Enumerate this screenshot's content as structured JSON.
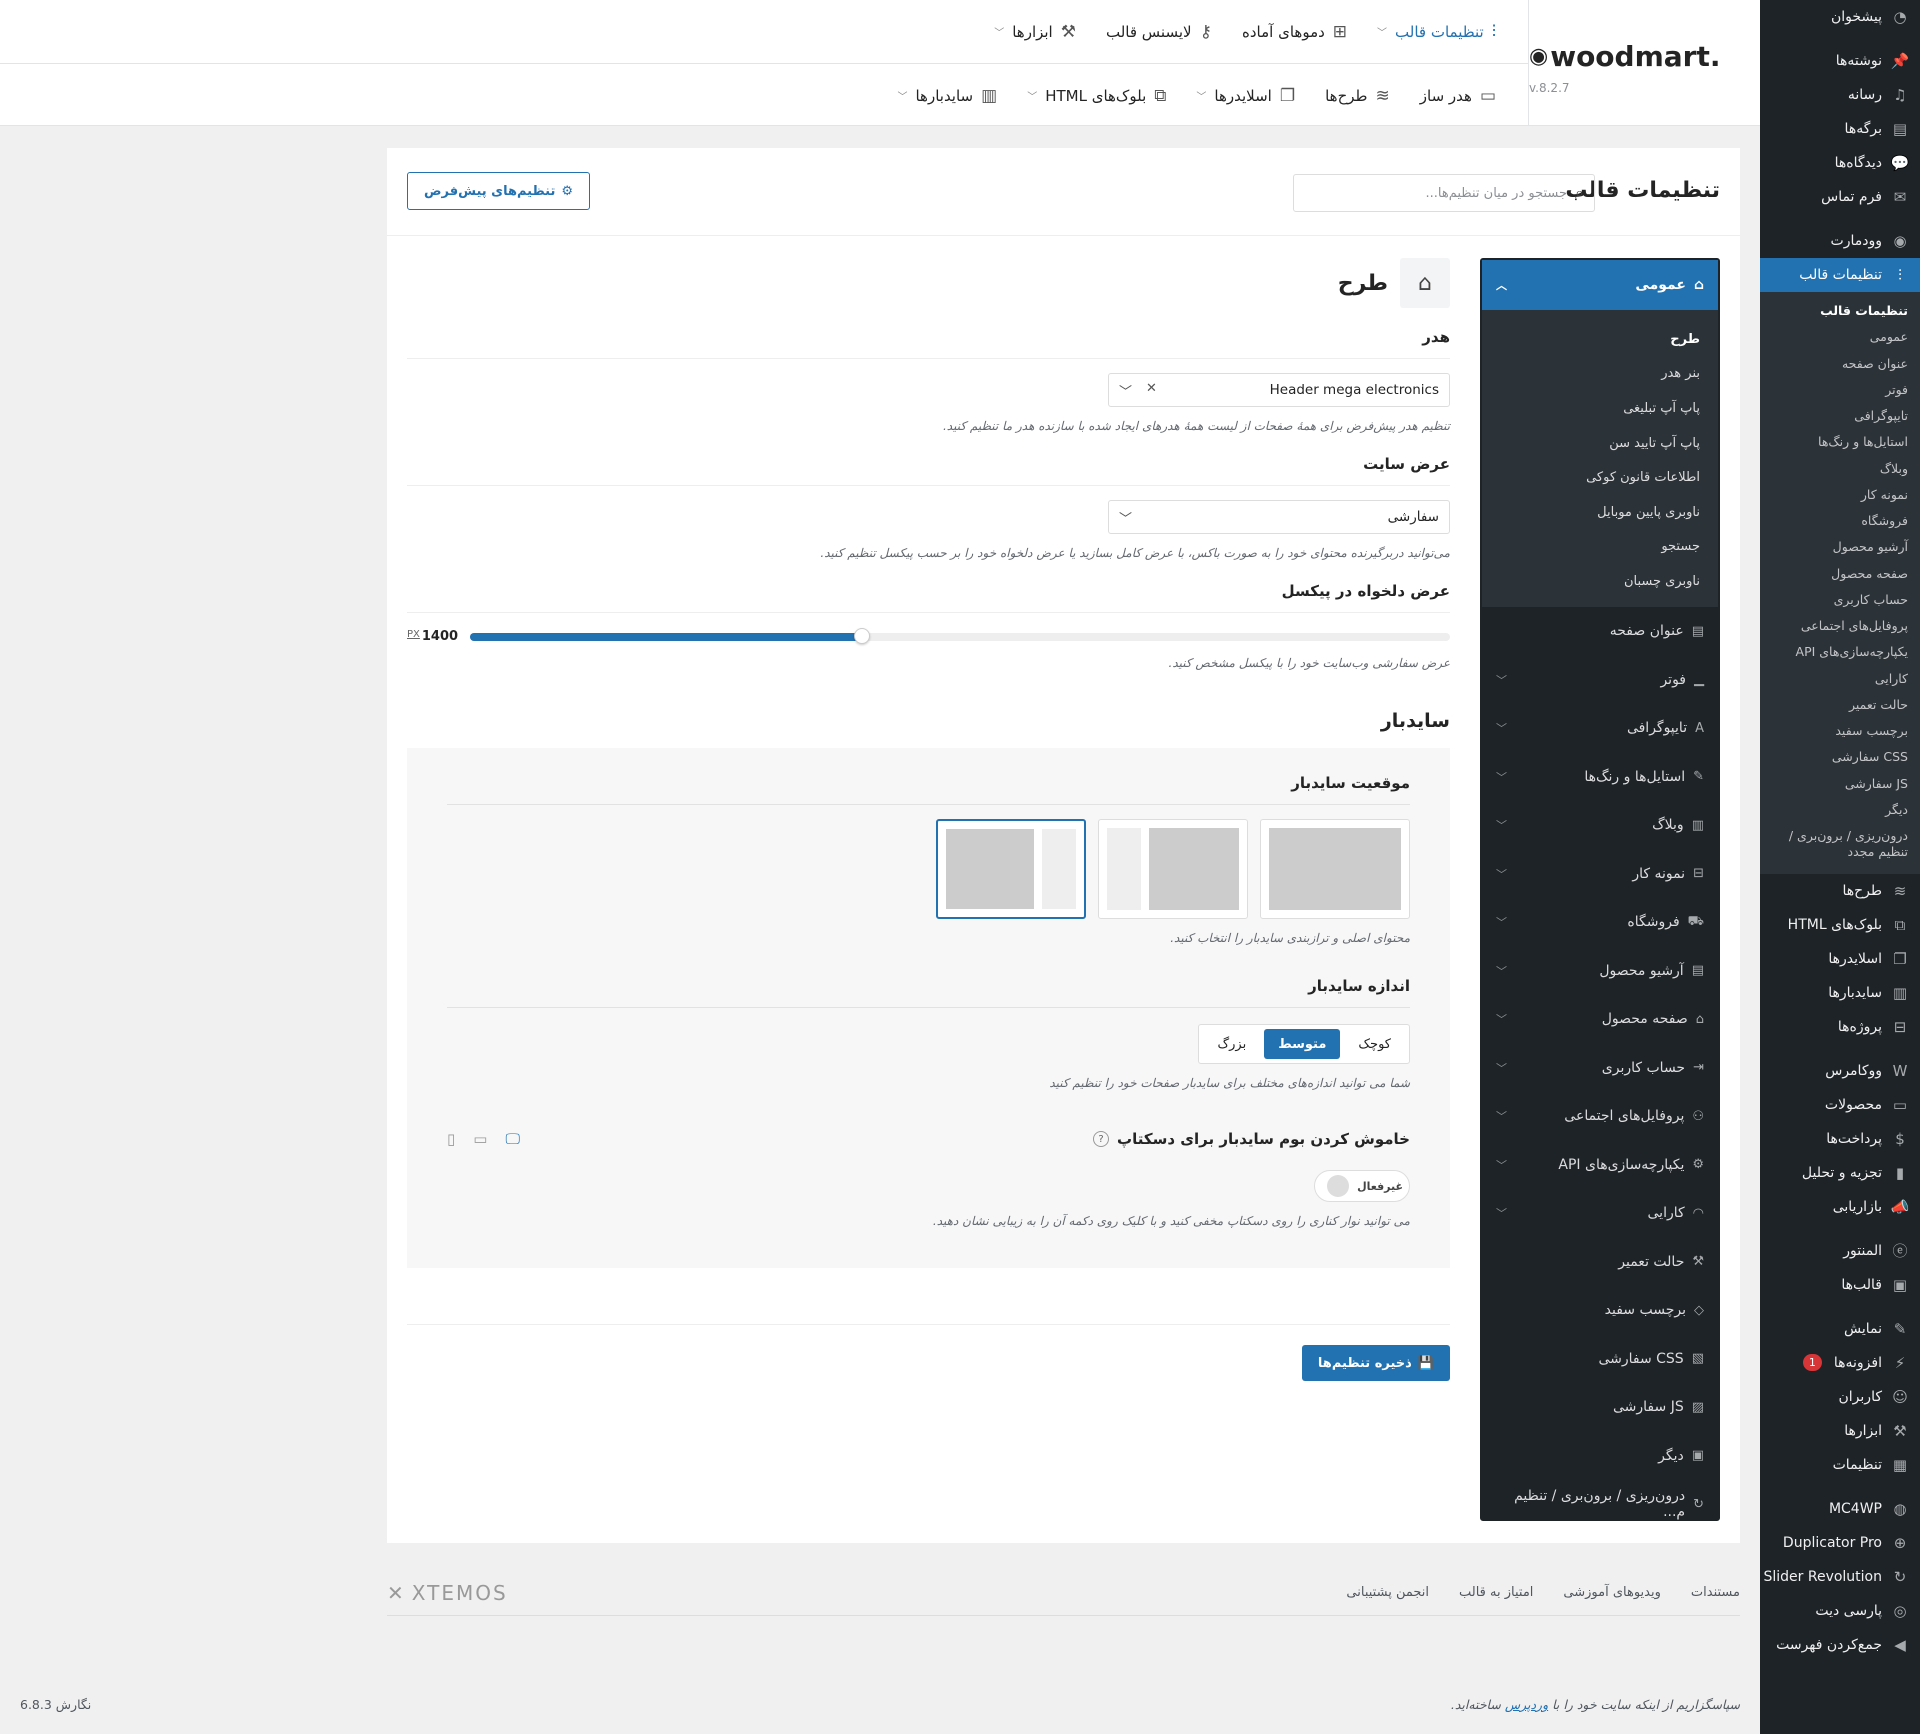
{
  "wp_sidebar": {
    "items_top": [
      {
        "label": "پیشخوان",
        "icon": "dashboard-icon"
      },
      {
        "label": "نوشته‌ها",
        "icon": "pin-icon",
        "sep": true
      },
      {
        "label": "رسانه",
        "icon": "media-icon"
      },
      {
        "label": "برگه‌ها",
        "icon": "page-icon"
      },
      {
        "label": "دیدگاه‌ها",
        "icon": "comment-icon"
      },
      {
        "label": "فرم تماس",
        "icon": "mail-icon"
      },
      {
        "label": "وودمارت",
        "icon": "woodmart-icon",
        "sep": true
      },
      {
        "label": "تنظیمات قالب",
        "icon": "sliders-icon",
        "active": true
      }
    ],
    "submenu": [
      {
        "label": "تنظیمات قالب",
        "current": true
      },
      {
        "label": "عمومی"
      },
      {
        "label": "عنوان صفحه"
      },
      {
        "label": "فوتر"
      },
      {
        "label": "تایپوگرافی"
      },
      {
        "label": "استایل‌ها و رنگ‌ها"
      },
      {
        "label": "وبلاگ"
      },
      {
        "label": "نمونه کار"
      },
      {
        "label": "فروشگاه"
      },
      {
        "label": "آرشیو محصول"
      },
      {
        "label": "صفحه محصول"
      },
      {
        "label": "حساب کاربری"
      },
      {
        "label": "پروفایل‌های اجتماعی"
      },
      {
        "label": "یکپارچه‌سازی‌های API"
      },
      {
        "label": "کارایی"
      },
      {
        "label": "حالت تعمیر"
      },
      {
        "label": "برچسب سفید"
      },
      {
        "label": "CSS سفارشی"
      },
      {
        "label": "JS سفارشی"
      },
      {
        "label": "دیگر"
      },
      {
        "label": "درون‌ریزی / برون‌بری / تنظیم مجدد"
      }
    ],
    "items_bottom": [
      {
        "label": "طرح‌ها",
        "icon": "layers-icon"
      },
      {
        "label": "بلوک‌های HTML",
        "icon": "html-block-icon"
      },
      {
        "label": "اسلایدرها",
        "icon": "slides-icon"
      },
      {
        "label": "سایدبارها",
        "icon": "sidebar-icon"
      },
      {
        "label": "پروژه‌ها",
        "icon": "portfolio-icon"
      },
      {
        "label": "ووکامرس",
        "icon": "woocommerce-icon",
        "sep": true
      },
      {
        "label": "محصولات",
        "icon": "products-icon"
      },
      {
        "label": "پرداخت‌ها",
        "icon": "payments-icon"
      },
      {
        "label": "تجزیه و تحلیل",
        "icon": "analytics-icon"
      },
      {
        "label": "بازاریابی",
        "icon": "megaphone-icon"
      },
      {
        "label": "المنتور",
        "icon": "elementor-icon",
        "sep": true
      },
      {
        "label": "قالب‌ها",
        "icon": "folder-icon"
      },
      {
        "label": "نمایش",
        "icon": "brush-icon",
        "sep": true
      },
      {
        "label": "افزونه‌ها",
        "icon": "plugin-icon",
        "badge": "1"
      },
      {
        "label": "کاربران",
        "icon": "user-icon"
      },
      {
        "label": "ابزارها",
        "icon": "wrench-icon"
      },
      {
        "label": "تنظیمات",
        "icon": "settings-icon"
      },
      {
        "label": "MC4WP",
        "icon": "mc4wp-icon",
        "sep": true
      },
      {
        "label": "Duplicator Pro",
        "icon": "duplicator-icon"
      },
      {
        "label": "Slider Revolution",
        "icon": "revslider-icon"
      },
      {
        "label": "پارسی دیت",
        "icon": "globe-icon"
      },
      {
        "label": "جمع‌کردن فهرست",
        "icon": "collapse-icon"
      }
    ]
  },
  "topbar": {
    "logo": "woodmart.",
    "version": "v.8.2.7",
    "nav1": [
      {
        "label": "تنظیمات قالب",
        "icon": "sliders-icon",
        "active": true,
        "chev": true
      },
      {
        "label": "دموهای آماده",
        "icon": "grid-icon"
      },
      {
        "label": "لایسنس قالب",
        "icon": "key-icon"
      },
      {
        "label": "ابزارها",
        "icon": "wrench-icon",
        "chev": true
      }
    ],
    "nav2": [
      {
        "label": "هدر ساز",
        "icon": "header-builder-icon"
      },
      {
        "label": "طرح‌ها",
        "icon": "layers-icon"
      },
      {
        "label": "اسلایدرها",
        "icon": "slides-icon",
        "chev": true
      },
      {
        "label": "بلوک‌های HTML",
        "icon": "html-block-icon",
        "chev": true
      },
      {
        "label": "سایدبارها",
        "icon": "sidebar-icon",
        "chev": true
      }
    ]
  },
  "panel": {
    "title": "تنظیمات قالب",
    "search_placeholder": "جستجو در میان تنظیم‌ها...",
    "defaults_button": "تنظیم‌های پیش‌فرض",
    "save_button": "ذخیره تنظیم‌ها"
  },
  "settings_nav": {
    "top": "عمومی",
    "sub": [
      {
        "label": "طرح",
        "current": true
      },
      {
        "label": "بنر هدر"
      },
      {
        "label": "پاپ آپ تبلیغی"
      },
      {
        "label": "پاپ آپ تایید سن"
      },
      {
        "label": "اطلاعات قانون کوکی"
      },
      {
        "label": "ناوبری پایین موبایل"
      },
      {
        "label": "جستجو"
      },
      {
        "label": "ناوبری چسبان"
      }
    ],
    "sections": [
      {
        "label": "عنوان صفحه",
        "icon": "page-title-icon",
        "chev": false
      },
      {
        "label": "فوتر",
        "icon": "footer-icon",
        "chev": true
      },
      {
        "label": "تایپوگرافی",
        "icon": "typography-icon",
        "chev": true
      },
      {
        "label": "استایل‌ها و رنگ‌ها",
        "icon": "brush-icon",
        "chev": true
      },
      {
        "label": "وبلاگ",
        "icon": "blog-icon",
        "chev": true
      },
      {
        "label": "نمونه کار",
        "icon": "portfolio-icon",
        "chev": true
      },
      {
        "label": "فروشگاه",
        "icon": "cart-icon",
        "chev": true
      },
      {
        "label": "آرشیو محصول",
        "icon": "archive-icon",
        "chev": true
      },
      {
        "label": "صفحه محصول",
        "icon": "bag-icon",
        "chev": true
      },
      {
        "label": "حساب کاربری",
        "icon": "login-icon",
        "chev": true
      },
      {
        "label": "پروفایل‌های اجتماعی",
        "icon": "social-icon",
        "chev": true
      },
      {
        "label": "یکپارچه‌سازی‌های API",
        "icon": "gear-icon",
        "chev": true
      },
      {
        "label": "کارایی",
        "icon": "gauge-icon",
        "chev": true
      },
      {
        "label": "حالت تعمیر",
        "icon": "wrench-icon",
        "chev": false
      },
      {
        "label": "برچسب سفید",
        "icon": "tag-icon",
        "chev": false
      },
      {
        "label": "CSS سفارشی",
        "icon": "css-file-icon",
        "chev": false
      },
      {
        "label": "JS سفارشی",
        "icon": "js-file-icon",
        "chev": false
      },
      {
        "label": "دیگر",
        "icon": "other-icon",
        "chev": false
      },
      {
        "label": "درون‌ریزی / برون‌بری / تنظیم م...",
        "icon": "reset-icon",
        "chev": false
      }
    ]
  },
  "content": {
    "page_title": "طرح",
    "header": {
      "label": "هدر",
      "value": "Header mega electronics",
      "hint": "تنظیم هدر پیش‌فرض برای همهٔ صفحات از لیست همهٔ هدرهای ایجاد شده با سازنده هدر ما تنظیم کنید."
    },
    "site_width": {
      "label": "عرض سایت",
      "value": "سفارشی",
      "hint": "می‌توانید دربرگیرنده محتوای خود را به صورت باکس، با عرض کامل بسازید یا عرض دلخواه خود را بر حسب پیکسل تنظیم کنید."
    },
    "custom_width": {
      "label": "عرض دلخواه در پیکسل",
      "value": "1400",
      "unit": "PX",
      "fill_fraction": 0.4,
      "hint": "عرض سفارشی وب‌سایت خود را با پیکسل مشخص کنید."
    },
    "sidebar_title": "سایدبار",
    "sidebar_position": {
      "label": "موقعیت سایدبار",
      "options": [
        "without",
        "left",
        "right"
      ],
      "selected": 2,
      "hint": "محتوای اصلی و ترازبندی سایدبار را انتخاب کنید."
    },
    "sidebar_size": {
      "label": "اندازه سایدبار",
      "options": [
        "کوچک",
        "متوسط",
        "بزرگ"
      ],
      "selected": 1,
      "hint": "شما می توانید اندازه‌های مختلف برای سایدبار صفحات خود را تنظیم کنید"
    },
    "off_canvas": {
      "label": "خاموش کردن بوم سایدبار برای دسکتاپ",
      "help": "?",
      "toggle_text": "غیرفعال",
      "hint": "می توانید نوار کناری را روی دسکتاپ مخفی کنید و با کلیک روی دکمه آن را به زیبایی نشان دهید."
    }
  },
  "footer": {
    "brand": "XTEMOS",
    "links": [
      "مستندات",
      "ویدیوهای آموزشی",
      "امتیاز به قالب",
      "انجمن پشتیبانی"
    ],
    "thanks_prefix": "سپاسگزاریم از اینکه سایت خود را با",
    "thanks_link": "وردپرس",
    "thanks_suffix": "ساخته‌اید.",
    "version": "نگارش 6.8.3"
  }
}
